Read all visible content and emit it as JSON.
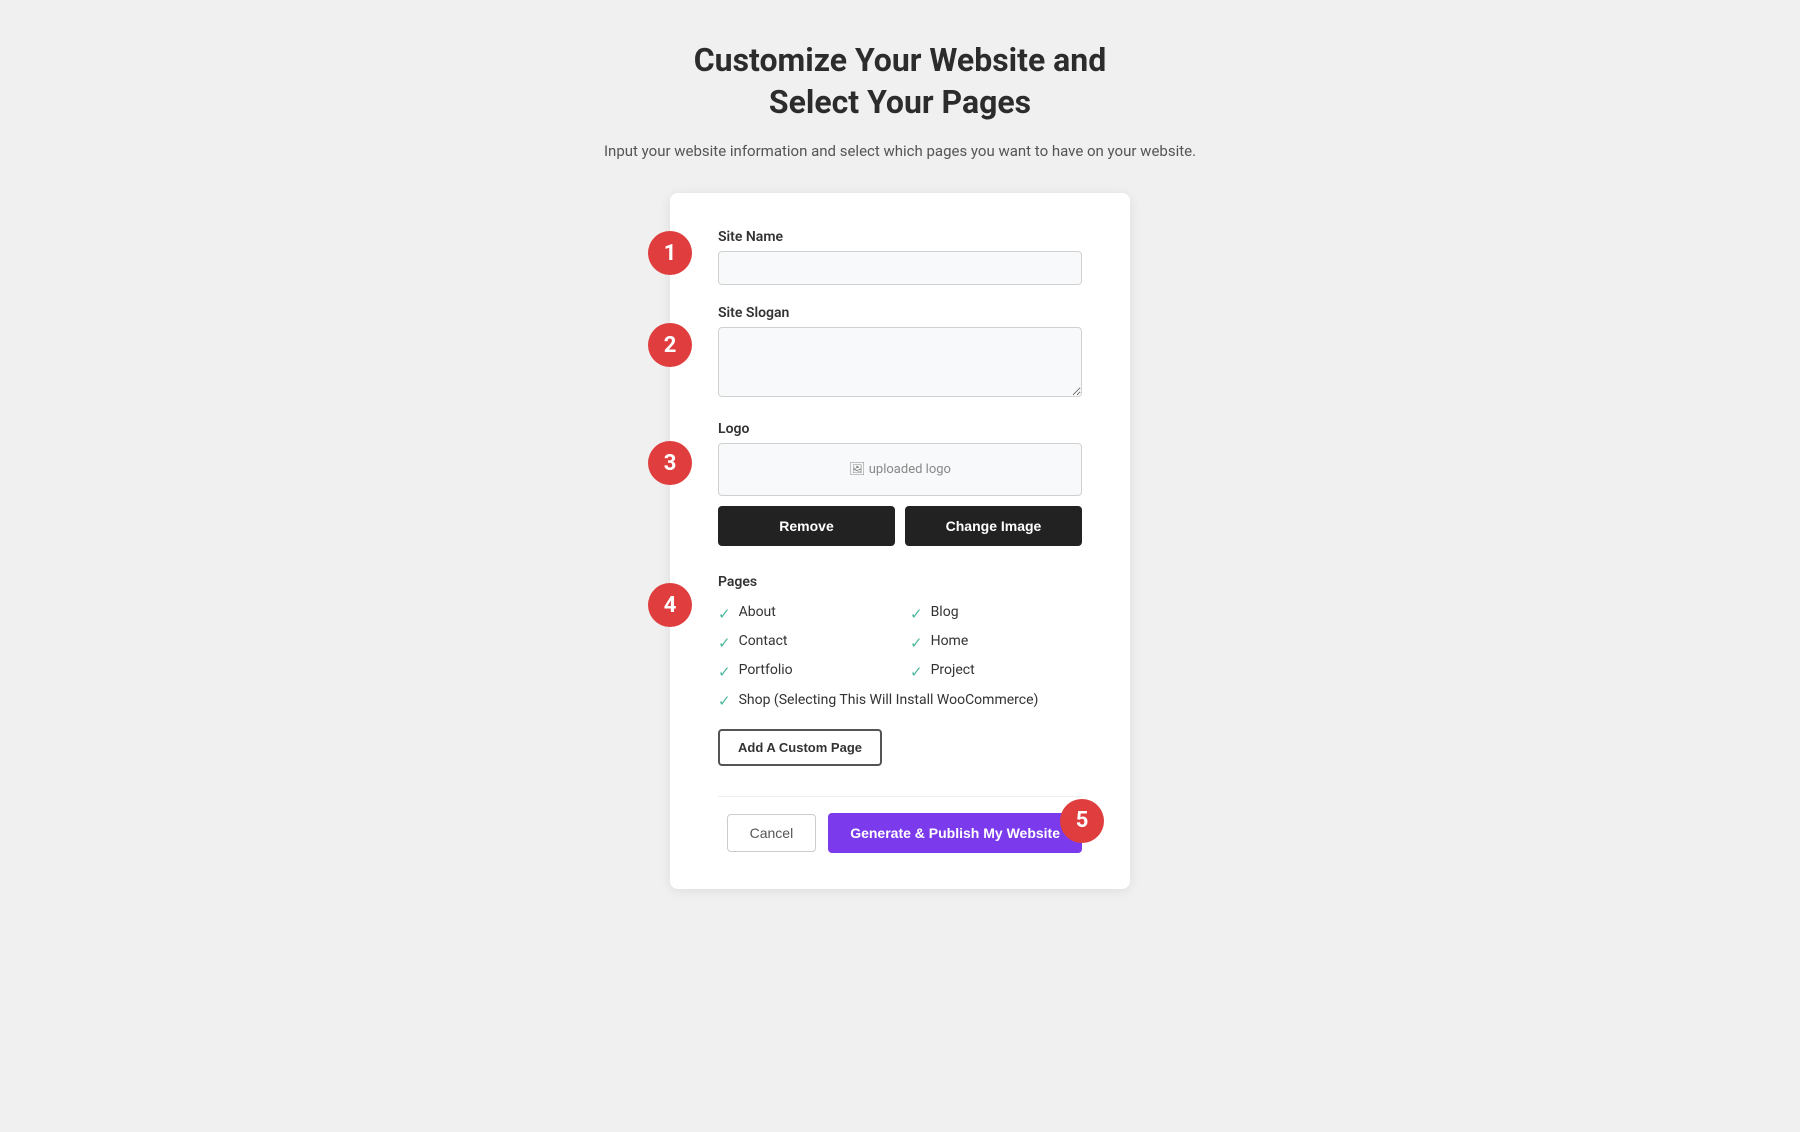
{
  "header": {
    "title": "Customize Your Website and\nSelect Your Pages",
    "subtitle": "Input your website information and select which pages you want to have on your website."
  },
  "steps": {
    "step1": "1",
    "step2": "2",
    "step3": "3",
    "step4": "4",
    "step5": "5"
  },
  "form": {
    "site_name_label": "Site Name",
    "site_name_placeholder": "",
    "site_slogan_label": "Site Slogan",
    "site_slogan_placeholder": "",
    "logo_label": "Logo",
    "logo_preview_text": "uploaded logo",
    "remove_button": "Remove",
    "change_image_button": "Change Image",
    "pages_label": "Pages",
    "pages": [
      {
        "name": "About",
        "checked": true
      },
      {
        "name": "Blog",
        "checked": true
      },
      {
        "name": "Contact",
        "checked": true
      },
      {
        "name": "Home",
        "checked": true
      },
      {
        "name": "Portfolio",
        "checked": true
      },
      {
        "name": "Project",
        "checked": true
      },
      {
        "name": "Shop (Selecting This Will Install WooCommerce)",
        "checked": true,
        "wide": true
      }
    ],
    "add_custom_page_button": "Add A Custom Page",
    "cancel_button": "Cancel",
    "publish_button": "Generate & Publish My Website"
  }
}
